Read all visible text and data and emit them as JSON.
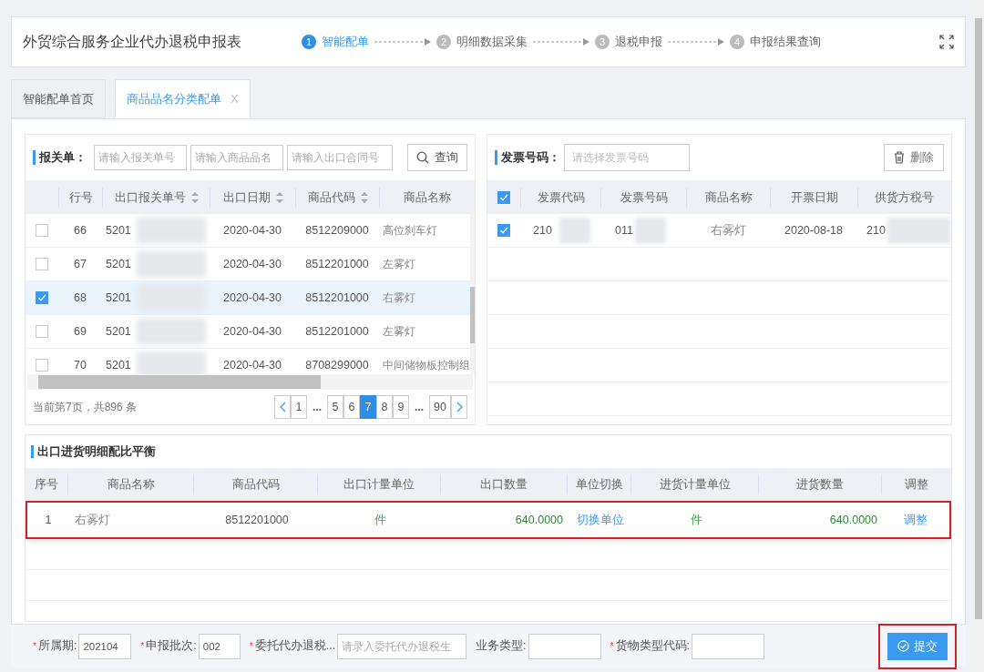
{
  "header": {
    "title": "外贸综合服务企业代办退税申报表",
    "steps": [
      {
        "num": "1",
        "label": "智能配单",
        "selected": true
      },
      {
        "num": "2",
        "label": "明细数据采集",
        "selected": false
      },
      {
        "num": "3",
        "label": "退税申报",
        "selected": false
      },
      {
        "num": "4",
        "label": "申报结果查询",
        "selected": false
      }
    ]
  },
  "tabs": [
    {
      "label": "智能配单首页",
      "selected": false,
      "closable": false
    },
    {
      "label": "商品品名分类配单",
      "selected": true,
      "closable": true,
      "close": "X"
    }
  ],
  "customs": {
    "label": "报关单：",
    "placeholders": [
      "请输入报关单号",
      "请输入商品品名",
      "请输入出口合同号"
    ],
    "button": "查询",
    "columns": [
      "行号",
      "出口报关单号",
      "出口日期",
      "商品代码",
      "商品名称"
    ],
    "rows": [
      {
        "checked": false,
        "row_no": "66",
        "decl_no": "5201",
        "date": "2020-04-30",
        "code": "8512209000",
        "name": "高位刹车灯"
      },
      {
        "checked": false,
        "row_no": "67",
        "decl_no": "5201",
        "date": "2020-04-30",
        "code": "8512201000",
        "name": "左雾灯"
      },
      {
        "checked": true,
        "row_no": "68",
        "decl_no": "5201",
        "date": "2020-04-30",
        "code": "8512201000",
        "name": "右雾灯"
      },
      {
        "checked": false,
        "row_no": "69",
        "decl_no": "5201",
        "date": "2020-04-30",
        "code": "8512201000",
        "name": "左雾灯"
      },
      {
        "checked": false,
        "row_no": "70",
        "decl_no": "5201",
        "date": "2020-04-30",
        "code": "8708299000",
        "name": "中间储物板控制组"
      }
    ],
    "summary": "当前第7页，共896 条",
    "pages": [
      {
        "label": "1",
        "kind": "page",
        "selected": false
      },
      {
        "label": "...",
        "kind": "gap"
      },
      {
        "label": "5",
        "kind": "page",
        "selected": false
      },
      {
        "label": "6",
        "kind": "page",
        "selected": false
      },
      {
        "label": "7",
        "kind": "page",
        "selected": true
      },
      {
        "label": "8",
        "kind": "page",
        "selected": false
      },
      {
        "label": "9",
        "kind": "page",
        "selected": false
      },
      {
        "label": "...",
        "kind": "gap"
      },
      {
        "label": "90",
        "kind": "page",
        "selected": false
      }
    ]
  },
  "invoice": {
    "label": "发票号码：",
    "placeholder": "请选择发票号码",
    "button": "删除",
    "all_checked": true,
    "columns": [
      "发票代码",
      "发票号码",
      "商品名称",
      "开票日期",
      "供货方税号"
    ],
    "rows": [
      {
        "checked": true,
        "code": "210",
        "number": "011",
        "name": "右雾灯",
        "date": "2020-08-18",
        "tax_no": "210"
      }
    ]
  },
  "balance": {
    "title": "出口进货明细配比平衡",
    "columns": [
      "序号",
      "商品名称",
      "商品代码",
      "出口计量单位",
      "出口数量",
      "单位切换",
      "进货计量单位",
      "进货数量",
      "调整"
    ],
    "rows": [
      {
        "highlighted": true,
        "no": "1",
        "name": "右雾灯",
        "code": "8512201000",
        "export_unit": "件",
        "export_qty": "640.0000",
        "switch": "切换单位",
        "import_unit": "件",
        "import_qty": "640.0000",
        "adjust": "调整"
      }
    ]
  },
  "form": {
    "required_mark": "*",
    "fields": [
      {
        "label": "所属期:",
        "required": true,
        "value": "202104"
      },
      {
        "label": "申报批次:",
        "required": true,
        "value": "002"
      },
      {
        "label": "委托代办退税...",
        "required": true,
        "placeholder": "请录入委托代办退税生"
      },
      {
        "label": "业务类型:",
        "required": false
      },
      {
        "label": "货物类型代码:",
        "required": true
      }
    ],
    "submit": "提交",
    "submit_highlighted": true
  }
}
